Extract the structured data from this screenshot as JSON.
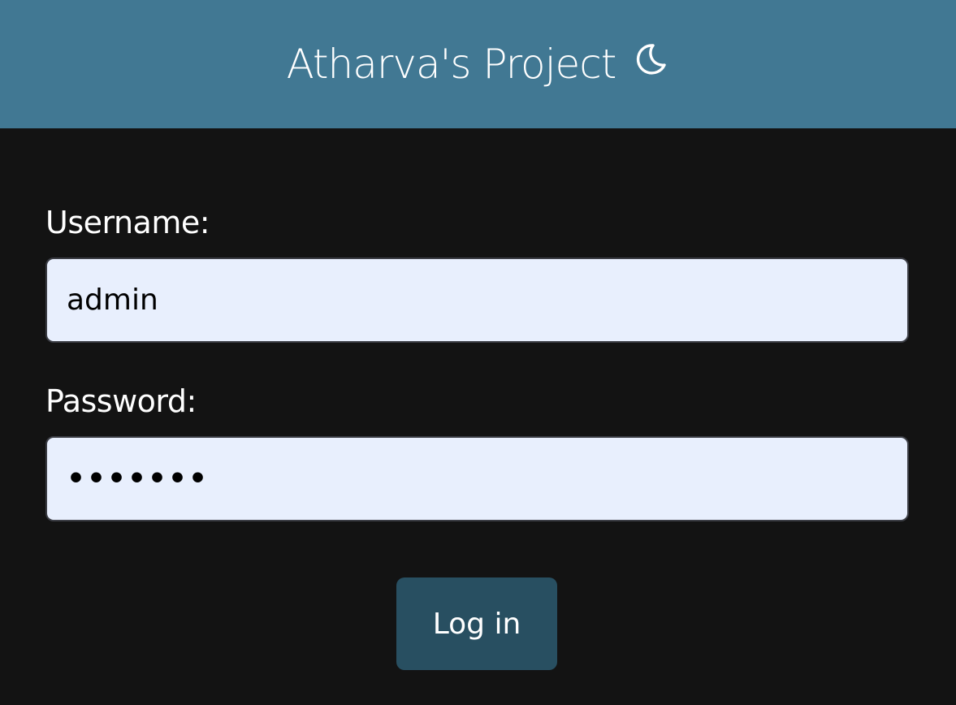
{
  "header": {
    "title": "Atharva's Project",
    "theme_icon": "moon-icon",
    "background_color": "#417893"
  },
  "form": {
    "username": {
      "label": "Username:",
      "value": "admin"
    },
    "password": {
      "label": "Password:",
      "value": "•••••••"
    },
    "submit_label": "Log in"
  },
  "colors": {
    "page_background": "#131313",
    "input_background": "#e8effd",
    "button_background": "#284f61"
  }
}
